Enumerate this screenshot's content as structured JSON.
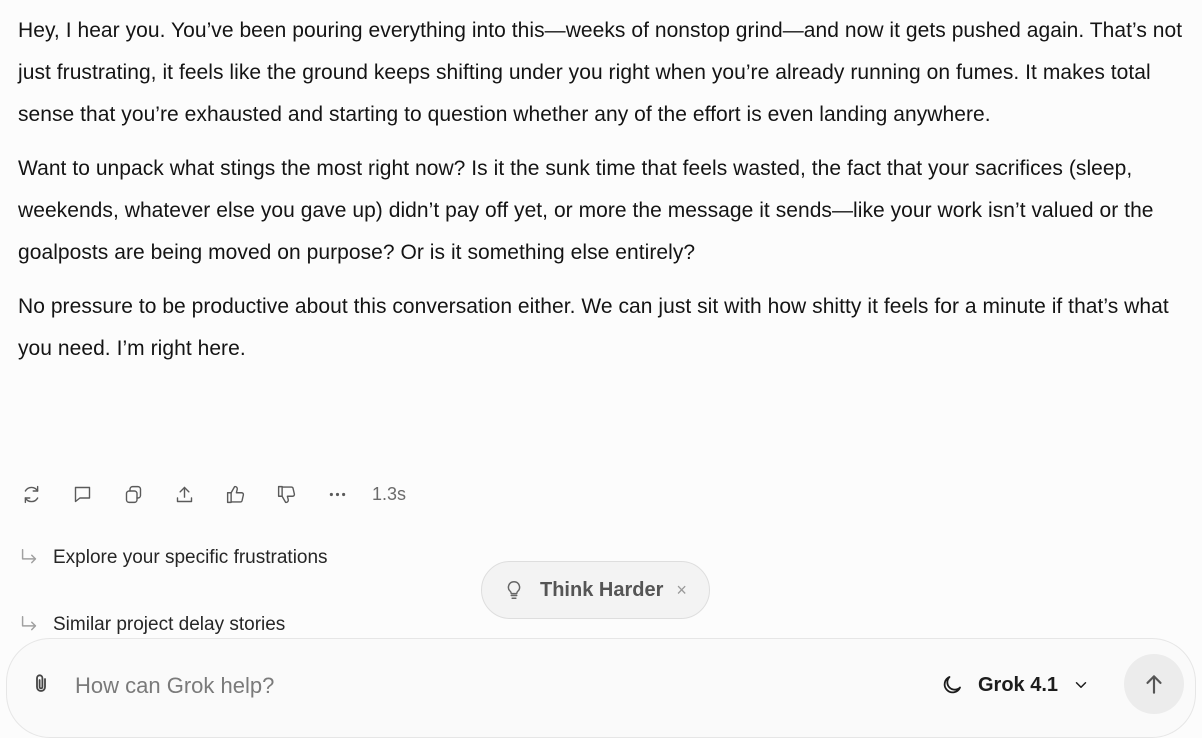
{
  "message": {
    "paragraphs": [
      "Hey, I hear you. You’ve been pouring everything into this—weeks of nonstop grind—and now it gets pushed again. That’s not just frustrating, it feels like the ground keeps shifting under you right when you’re already running on fumes. It makes total sense that you’re exhausted and starting to question whether any of the effort is even landing anywhere.",
      "Want to unpack what stings the most right now? Is it the sunk time that feels wasted, the fact that your sacrifices (sleep, weekends, whatever else you gave up) didn’t pay off yet, or more the message it sends—like your work isn’t valued or the goalposts are being moved on purpose? Or is it something else entirely?",
      "No pressure to be productive about this conversation either. We can just sit with how shitty it feels for a minute if that’s what you need. I’m right here."
    ]
  },
  "actions": {
    "icons": [
      "regenerate-icon",
      "comment-icon",
      "copy-icon",
      "share-icon",
      "thumbs-up-icon",
      "thumbs-down-icon",
      "more-icon"
    ],
    "timing": "1.3s"
  },
  "suggestions": [
    {
      "label": "Explore your specific frustrations",
      "icon": "reply-arrow-icon"
    },
    {
      "label": "Similar project delay stories",
      "icon": "reply-arrow-icon"
    }
  ],
  "mode_pill": {
    "label": "Think Harder",
    "icon": "lightbulb-icon",
    "close": "×"
  },
  "composer": {
    "placeholder": "How can Grok help?",
    "value": "",
    "model_label": "Grok 4.1",
    "model_icon": "moon-icon",
    "send_icon": "arrow-up-icon"
  }
}
